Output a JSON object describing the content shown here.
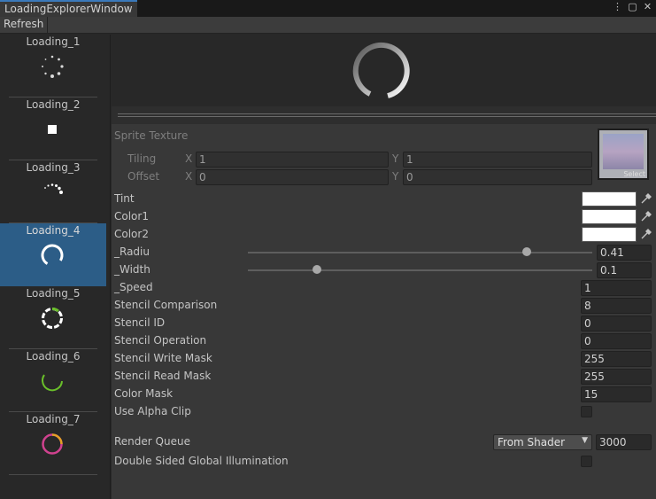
{
  "window": {
    "title": "LoadingExplorerWindow",
    "menu_icon": "⋮",
    "maximize_icon": "▢",
    "close_icon": "✕"
  },
  "toolbar": {
    "refresh_label": "Refresh"
  },
  "sidebar": {
    "items": [
      {
        "label": "Loading_1",
        "icon": "dotted-spinner-icon"
      },
      {
        "label": "Loading_2",
        "icon": "square-icon"
      },
      {
        "label": "Loading_3",
        "icon": "dot-arc-spinner-icon"
      },
      {
        "label": "Loading_4",
        "icon": "ring-spinner-icon"
      },
      {
        "label": "Loading_5",
        "icon": "dashed-ring-icon"
      },
      {
        "label": "Loading_6",
        "icon": "green-arc-icon"
      },
      {
        "label": "Loading_7",
        "icon": "pink-orange-ring-icon"
      }
    ],
    "selected_index": 3,
    "selected_color": "#2c5d87"
  },
  "material": {
    "sprite_texture_label": "Sprite Texture",
    "texture_select_label": "Select",
    "tiling": {
      "label": "Tiling",
      "x_label": "X",
      "x": "1",
      "y_label": "Y",
      "y": "1"
    },
    "offset": {
      "label": "Offset",
      "x_label": "X",
      "x": "0",
      "y_label": "Y",
      "y": "0"
    },
    "tint_label": "Tint",
    "color1_label": "Color1",
    "color2_label": "Color2",
    "radiu": {
      "label": "_Radiu",
      "value": "0.41",
      "fraction": 0.81
    },
    "width": {
      "label": "_Width",
      "value": "0.1",
      "fraction": 0.2
    },
    "speed": {
      "label": "_Speed",
      "value": "1"
    },
    "stencil_comparison": {
      "label": "Stencil Comparison",
      "value": "8"
    },
    "stencil_id": {
      "label": "Stencil ID",
      "value": "0"
    },
    "stencil_operation": {
      "label": "Stencil Operation",
      "value": "0"
    },
    "stencil_write_mask": {
      "label": "Stencil Write Mask",
      "value": "255"
    },
    "stencil_read_mask": {
      "label": "Stencil Read Mask",
      "value": "255"
    },
    "color_mask": {
      "label": "Color Mask",
      "value": "15"
    },
    "use_alpha_clip_label": "Use Alpha Clip",
    "render_queue": {
      "label": "Render Queue",
      "dropdown": "From Shader",
      "value": "3000"
    },
    "double_sided_label": "Double Sided Global Illumination"
  },
  "colors": {
    "accent": "#3a79bb",
    "green": "#6abf2a",
    "pink": "#d0428f",
    "orange": "#e5a025"
  }
}
